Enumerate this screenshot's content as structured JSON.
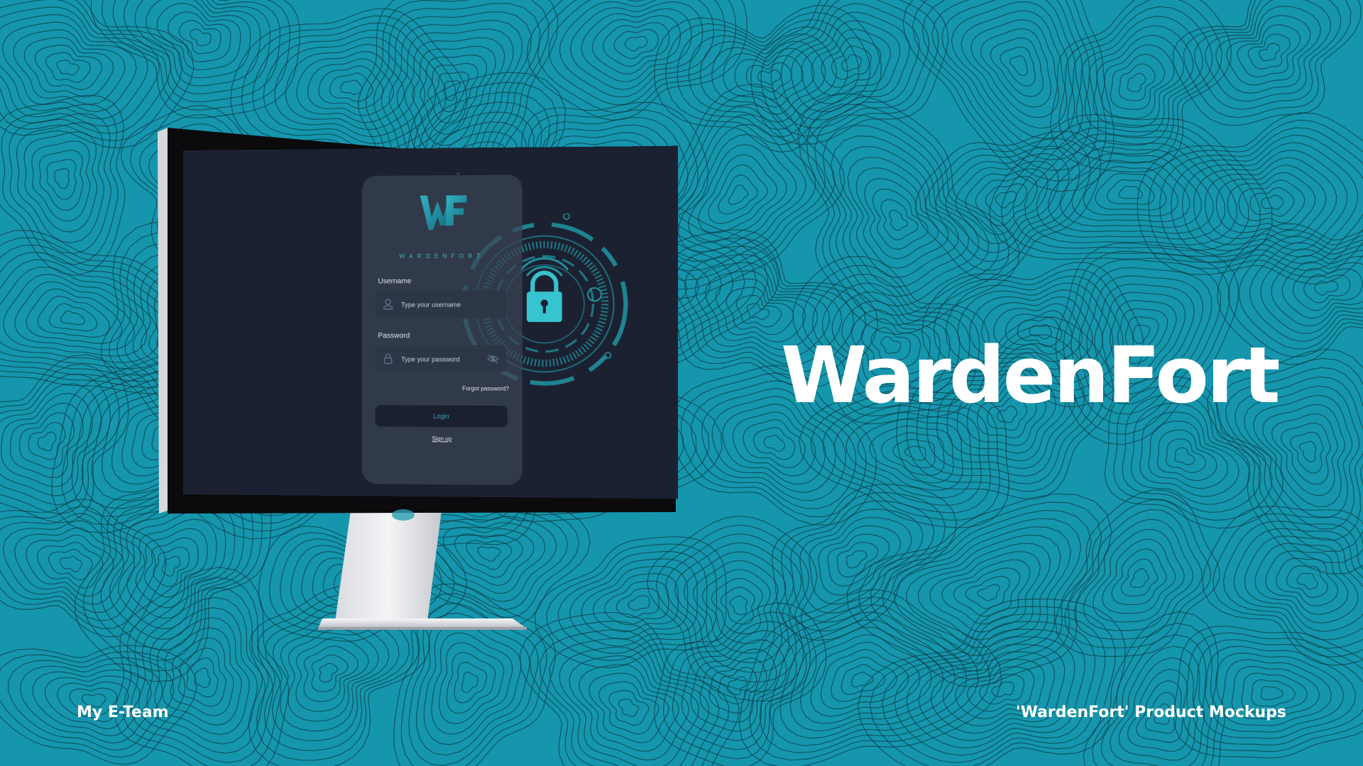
{
  "background": {
    "color": "#1596ad",
    "pattern": "topographic-contour-lines"
  },
  "hero": {
    "title": "WardenFort"
  },
  "footer": {
    "left": "My E-Team",
    "right": "'WardenFort' Product Mockups"
  },
  "device": {
    "type": "desktop-monitor",
    "frame_color": "#e3e5e8",
    "bezel_color": "#0b0b0d"
  },
  "app": {
    "brand": "WARDENFORT",
    "logo_text": "WF",
    "background": "#1c2131",
    "card_color": "#3a4454",
    "accent": "#3fb9c6",
    "username": {
      "label": "Username",
      "placeholder": "Type your username",
      "icon": "user-icon"
    },
    "password": {
      "label": "Password",
      "placeholder": "Type your password",
      "icon": "lock-icon",
      "toggle_icon": "eye-off-icon"
    },
    "forgot_label": "Forgot password?",
    "login_label": "Login",
    "signup_label": "Sign up",
    "illustration": "padlock-security-rings"
  }
}
